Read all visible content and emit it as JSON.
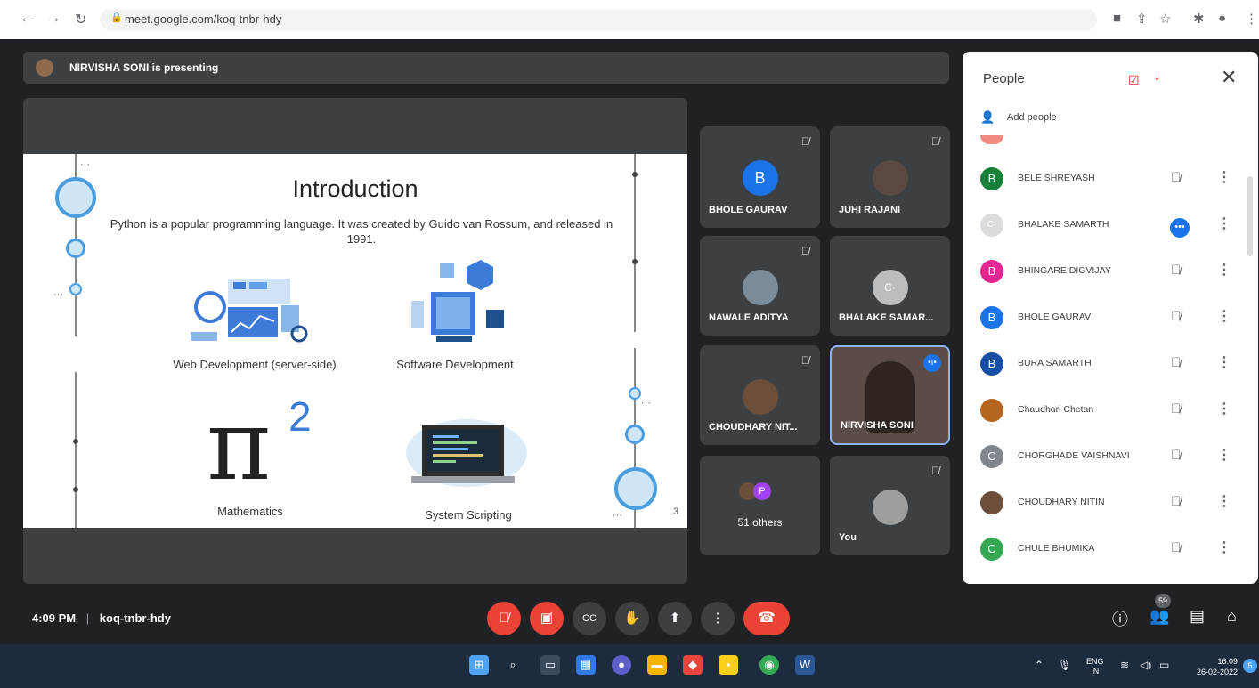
{
  "browser": {
    "url": "meet.google.com/koq-tnbr-hdy",
    "back_icon": "arrow-left-icon",
    "forward_icon": "arrow-right-icon",
    "reload_icon": "reload-icon"
  },
  "banner": {
    "text": "NIRVISHA SONI is presenting"
  },
  "slide": {
    "title": "Introduction",
    "subtitle": "Python is a popular programming language. It was created by Guido van Rossum, and released in 1991.",
    "captions": [
      "Web Development (server-side)",
      "Software Development",
      "Mathematics",
      "System Scripting"
    ],
    "pi_symbol": "π",
    "superscript": "2",
    "page_number": "3"
  },
  "tiles": [
    {
      "name": "BHOLE GAURAV",
      "initial": "B",
      "color": "#1a73e8"
    },
    {
      "name": "JUHI RAJANI",
      "initial": "",
      "color": "#5a4a42"
    },
    {
      "name": "NAWALE ADITYA",
      "initial": "",
      "color": "#7a8c99"
    },
    {
      "name": "BHALAKE SAMAR...",
      "initial": "C·",
      "color": "#bdbdbd"
    },
    {
      "name": "CHOUDHARY NIT...",
      "initial": "",
      "color": "#6b4f3a"
    },
    {
      "name": "NIRVISHA SONI",
      "initial": "",
      "color": "#8b6b55"
    },
    {
      "name": "51 others",
      "initial": "P",
      "color": "#a142f4"
    },
    {
      "name": "You",
      "initial": "",
      "color": "#9e9e9e"
    }
  ],
  "people": {
    "title": "People",
    "add_label": "Add people",
    "count_badge": "59",
    "list": [
      {
        "name": "BELE SHREYASH",
        "initial": "B",
        "color": "#188038"
      },
      {
        "name": "BHALAKE SAMARTH",
        "initial": "C·",
        "color": "#dadce0"
      },
      {
        "name": "BHINGARE DIGVIJAY",
        "initial": "B",
        "color": "#e52592"
      },
      {
        "name": "BHOLE GAURAV",
        "initial": "B",
        "color": "#1a73e8"
      },
      {
        "name": "BURA SAMARTH",
        "initial": "B",
        "color": "#174ea6"
      },
      {
        "name": "Chaudhari Chetan",
        "initial": "",
        "color": "#b5651d"
      },
      {
        "name": "CHORGHADE VAISHNAVI",
        "initial": "C",
        "color": "#80868b"
      },
      {
        "name": "CHOUDHARY NITIN",
        "initial": "",
        "color": "#6b4f3a"
      },
      {
        "name": "CHULE BHUMIKA",
        "initial": "C",
        "color": "#34a853"
      }
    ]
  },
  "controls": {
    "time": "4:09 PM",
    "meeting_code": "koq-tnbr-hdy"
  },
  "taskbar": {
    "lang_top": "ENG",
    "lang_bottom": "IN",
    "time": "16:09",
    "date": "26-02-2022",
    "notif": "5"
  }
}
